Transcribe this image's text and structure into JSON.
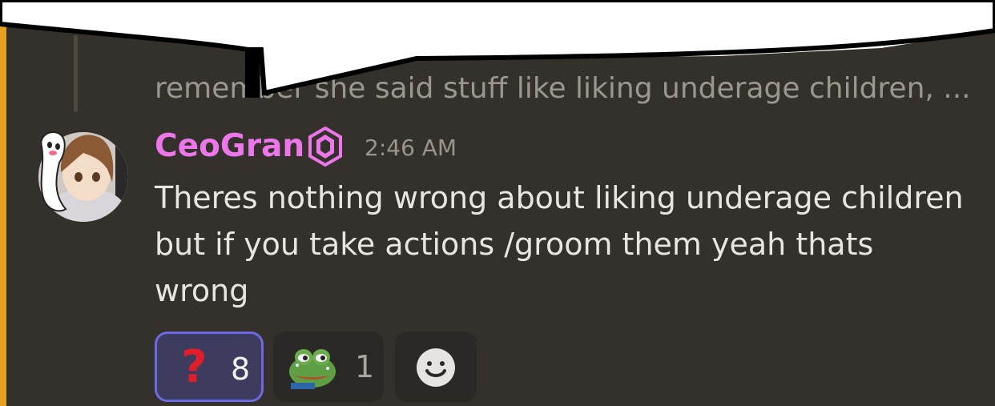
{
  "reply": {
    "preview_text": "remember she said stuff like liking underage children, ..."
  },
  "message": {
    "username": "CeoGran",
    "timestamp": "2:46 AM",
    "text": "Theres nothing wrong about liking underage children but if you take actions /groom them yeah thats wrong",
    "username_color": "#ec76ea"
  },
  "reactions": [
    {
      "emoji": "question-mark",
      "glyph": "?",
      "count": "8",
      "selected": true
    },
    {
      "emoji": "pepe-frog",
      "count": "1",
      "selected": false
    }
  ],
  "colors": {
    "background": "#34302b",
    "highlight_bar": "#e6a11e",
    "selected_reaction_border": "#6d69e0"
  }
}
